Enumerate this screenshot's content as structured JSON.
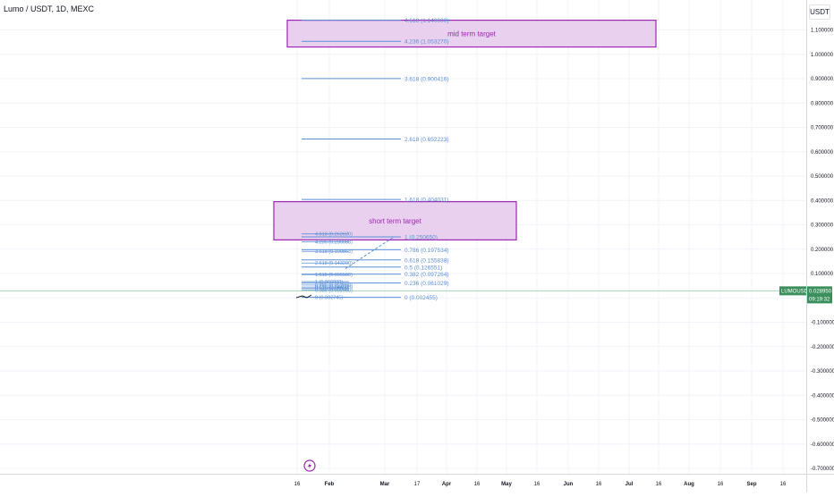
{
  "header": {
    "title": "Lumo / USDT, 1D, MEXC",
    "currency": "USDT"
  },
  "chart_data": {
    "type": "line",
    "symbol_label": "LUMOUSDT",
    "last_price": "0.028950",
    "countdown": "09:19:32",
    "y_ticks": [
      "1.100000",
      "1.000000",
      "0.900000",
      "0.800000",
      "0.700000",
      "0.600000",
      "0.500000",
      "0.400000",
      "0.300000",
      "0.200000",
      "0.100000",
      "",
      "-0.100000",
      "-0.200000",
      "-0.300000",
      "-0.400000",
      "-0.500000",
      "-0.600000",
      "-0.700000"
    ],
    "y_tick_values": [
      1.1,
      1.0,
      0.9,
      0.8,
      0.7,
      0.6,
      0.5,
      0.4,
      0.3,
      0.2,
      0.1,
      0.0,
      -0.1,
      -0.2,
      -0.3,
      -0.4,
      -0.5,
      -0.6,
      -0.7
    ],
    "ylim": [
      -0.7,
      1.1
    ],
    "x_ticks": [
      {
        "label": "16",
        "month": false
      },
      {
        "label": "Feb",
        "month": true
      },
      {
        "label": "Mar",
        "month": true
      },
      {
        "label": "17",
        "month": false
      },
      {
        "label": "Apr",
        "month": true
      },
      {
        "label": "16",
        "month": false
      },
      {
        "label": "May",
        "month": true
      },
      {
        "label": "16",
        "month": false
      },
      {
        "label": "Jun",
        "month": true
      },
      {
        "label": "16",
        "month": false
      },
      {
        "label": "Jul",
        "month": true
      },
      {
        "label": "16",
        "month": false
      },
      {
        "label": "Aug",
        "month": true
      },
      {
        "label": "16",
        "month": false
      },
      {
        "label": "Sep",
        "month": true
      },
      {
        "label": "16",
        "month": false
      }
    ],
    "fib_primary": [
      {
        "label": "4.618 (1.140000)",
        "value": 1.14
      },
      {
        "label": "4.236 (1.053270)",
        "value": 1.05327
      },
      {
        "label": "3.618 (0.900416)",
        "value": 0.900416
      },
      {
        "label": "2.618 (0.652223)",
        "value": 0.652223
      },
      {
        "label": "1.618 (0.404031)",
        "value": 0.404031
      },
      {
        "label": "1 (0.250650)",
        "value": 0.25065
      },
      {
        "label": "0.786 (0.197534)",
        "value": 0.197534
      },
      {
        "label": "0.618 (0.155838)",
        "value": 0.155838
      },
      {
        "label": "0.5 (0.126551)",
        "value": 0.126551
      },
      {
        "label": "0.382 (0.097264)",
        "value": 0.097264
      },
      {
        "label": "0.236 (0.061029)",
        "value": 0.061029
      },
      {
        "label": "0 (0.002455)",
        "value": 0.002455
      }
    ],
    "fib_secondary": [
      {
        "label": "4.618 (0.262620)",
        "value": 0.26262
      },
      {
        "label": "4.236 (0.230088)",
        "value": 0.230088
      },
      {
        "label": "3.618 (0.190863)",
        "value": 0.190863
      },
      {
        "label": "2.618 (0.143200)",
        "value": 0.1432
      },
      {
        "label": "1.618 (0.095500)",
        "value": 0.0955
      },
      {
        "label": "1 (0.066800)",
        "value": 0.0668
      },
      {
        "label": "0.786 (0.052800)",
        "value": 0.0528
      },
      {
        "label": "0.618 (0.044500)",
        "value": 0.0445
      },
      {
        "label": "0.5 (0.038800)",
        "value": 0.0388
      },
      {
        "label": "0.382 (0.032900)",
        "value": 0.0329
      },
      {
        "label": "0 (0.002745)",
        "value": 0.002745
      }
    ],
    "zones": [
      {
        "label": "mid term target",
        "top": 1.14,
        "bottom": 1.03
      },
      {
        "label": "short term target",
        "top": 0.395,
        "bottom": 0.238
      }
    ],
    "colors": {
      "fib": "#5b8fd6",
      "zone_fill": "#e5c8ec",
      "zone_border": "#9c27b0",
      "price_tag": "#3b8f5c",
      "grid": "#f0f3fa"
    },
    "grid": true
  },
  "icons": {
    "lightning": "lightning-icon"
  }
}
